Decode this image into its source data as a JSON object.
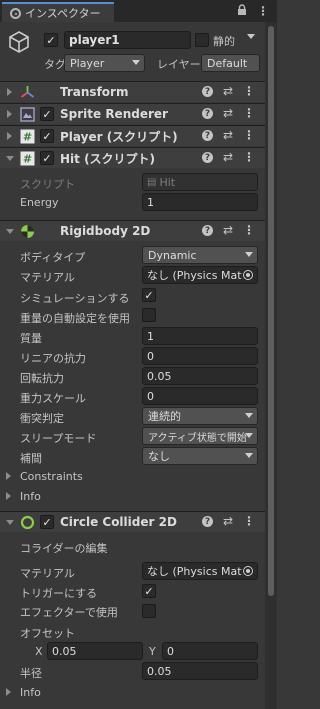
{
  "tab": {
    "title": "インスペクター",
    "lock_icon": "lock-icon",
    "more_icon": "kebab-menu-icon"
  },
  "gameobject": {
    "name": "player1",
    "static_label": "静的",
    "tag_label": "タグ",
    "tag_value": "Player",
    "layer_label": "レイヤー",
    "layer_value": "Default"
  },
  "components": {
    "transform": {
      "title": "Transform"
    },
    "sprite_renderer": {
      "title": "Sprite Renderer"
    },
    "player_script": {
      "title": "Player (スクリプト)"
    },
    "hit_script": {
      "title": "Hit (スクリプト)",
      "script_label": "スクリプト",
      "script_value": "Hit",
      "energy_label": "Energy",
      "energy_value": "1"
    },
    "rigidbody2d": {
      "title": "Rigidbody 2D",
      "body_type_label": "ボディタイプ",
      "body_type_value": "Dynamic",
      "material_label": "マテリアル",
      "material_value": "なし (Physics Mat",
      "simulated_label": "シミュレーションする",
      "auto_mass_label": "重量の自動設定を使用",
      "mass_label": "質量",
      "mass_value": "1",
      "linear_drag_label": "リニアの抗力",
      "linear_drag_value": "0",
      "angular_drag_label": "回転抗力",
      "angular_drag_value": "0.05",
      "gravity_scale_label": "重力スケール",
      "gravity_scale_value": "0",
      "collision_detection_label": "衝突判定",
      "collision_detection_value": "連続的",
      "sleep_mode_label": "スリープモード",
      "sleep_mode_value": "アクティブ状態で開始",
      "interpolate_label": "補間",
      "interpolate_value": "なし",
      "constraints_label": "Constraints",
      "info_label": "Info"
    },
    "circle_collider2d": {
      "title": "Circle Collider 2D",
      "edit_collider_label": "コライダーの編集",
      "material_label": "マテリアル",
      "material_value": "なし (Physics Mat",
      "is_trigger_label": "トリガーにする",
      "used_by_effector_label": "エフェクターで使用",
      "offset_label": "オフセット",
      "offset_x_label": "X",
      "offset_x_value": "0.05",
      "offset_y_label": "Y",
      "offset_y_value": "0",
      "radius_label": "半径",
      "radius_value": "0.05",
      "info_label": "Info"
    }
  },
  "colors": {
    "accent": "#5a8ed8",
    "panel": "#383838",
    "header": "#3e3e3e",
    "field": "#2a2a2a"
  }
}
